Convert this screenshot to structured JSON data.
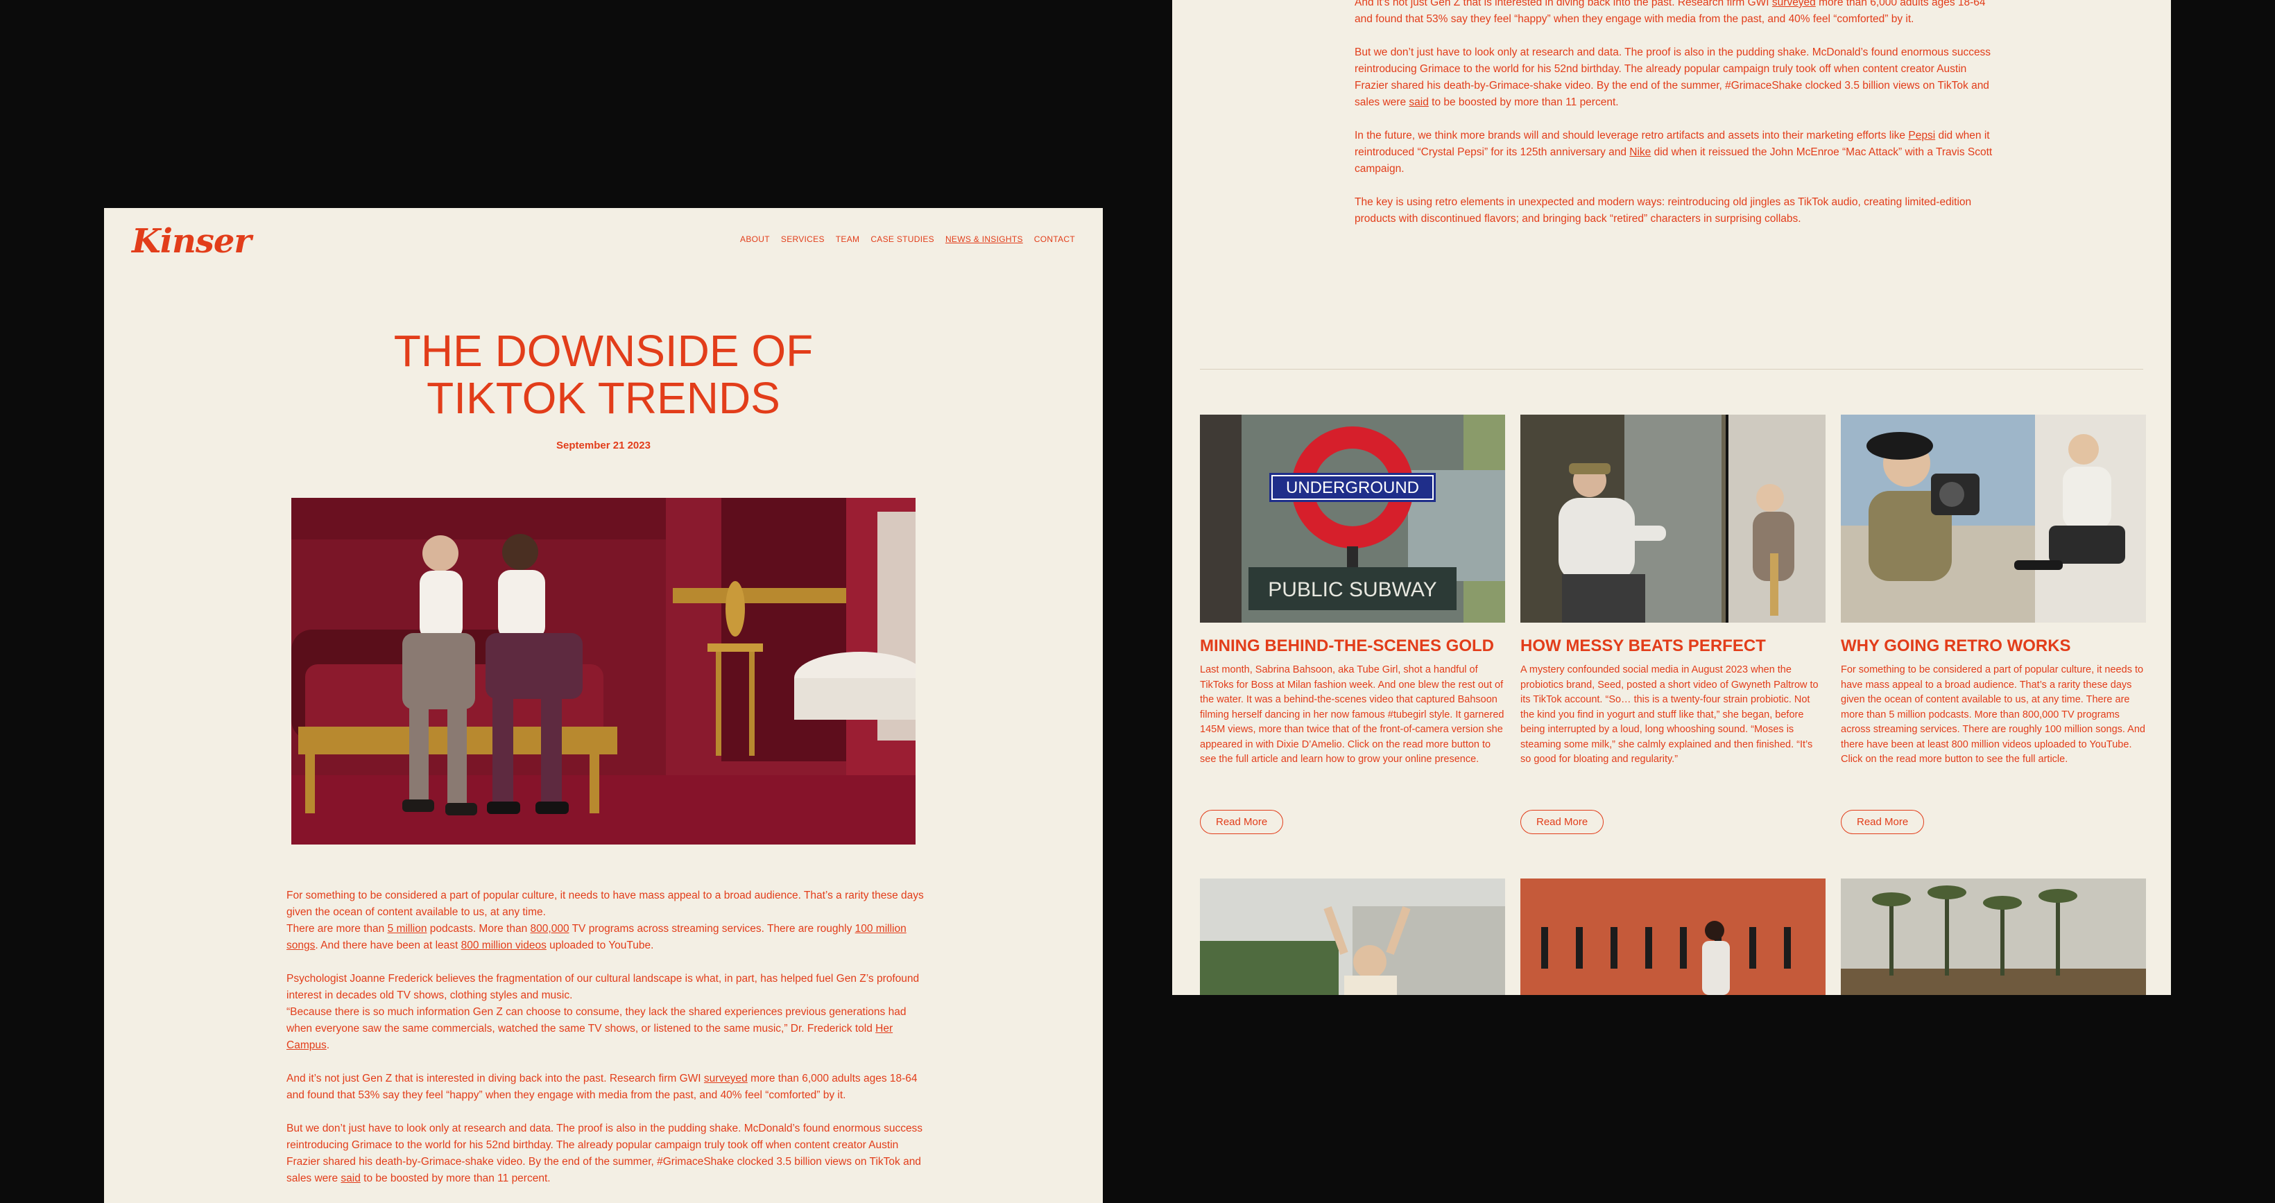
{
  "brand": {
    "logo": "Kinser",
    "color": "#e23d1a",
    "background": "#f3efe4"
  },
  "nav": [
    {
      "label": "ABOUT"
    },
    {
      "label": "SERVICES"
    },
    {
      "label": "TEAM"
    },
    {
      "label": "CASE STUDIES"
    },
    {
      "label": "NEWS & INSIGHTS",
      "active": true
    },
    {
      "label": "CONTACT"
    }
  ],
  "article": {
    "title_line1": "THE DOWNSIDE OF",
    "title_line2": "TIKTOK TRENDS",
    "date": "September 21 2023",
    "p1": {
      "a": "For something to be considered a part of popular culture, it needs to have mass appeal to a broad audience. That’s a rarity these days given the ocean of content available to us, at any time.",
      "b": "There are more than ",
      "l1": "5 million",
      "c": " podcasts. More than ",
      "l2": "800,000",
      "d": " TV programs across streaming services. There are roughly ",
      "l3": "100 million songs",
      "e": ". And there have been at least ",
      "l4": "800 million videos",
      "f": " uploaded to YouTube."
    },
    "p2": {
      "a": "Psychologist Joanne Frederick believes the fragmentation of our cultural landscape is what, in part, has helped fuel Gen Z’s profound interest in decades old TV shows, clothing styles and music.",
      "b": "“Because there is so much information Gen Z can choose to consume, they lack the shared experiences previous generations had when everyone saw the same commercials, watched the same TV shows, or listened to the same music,” Dr. Frederick told ",
      "l1": "Her Campus",
      "c": "."
    },
    "p3": {
      "a": "And it’s not just Gen Z that is interested in diving back into the past. Research firm GWI ",
      "l1": "surveyed",
      "b": " more than 6,000 adults ages 18-64 and found that 53% say they feel “happy” when they engage with media from the past, and 40% feel “comforted” by it."
    },
    "p4": {
      "a": "But we don’t just have to look only at research and data. The proof is also in the pudding shake. McDonald’s found enormous success reintroducing Grimace to the world for his 52nd birthday. The already popular campaign truly took off when content creator Austin Frazier shared his death-by-Grimace-shake video. By the end of the summer, #GrimaceShake clocked 3.5 billion views on TikTok and sales were ",
      "l1": "said",
      "b": " to be boosted by more than 11 percent."
    },
    "p5": {
      "a": "In the future, we think more brands will and should leverage retro artifacts and assets into their marketing efforts like ",
      "l1": "Pepsi",
      "b": " did when it reintroduced “Crystal Pepsi” for its 125th anniversary and ",
      "l2": "Nike",
      "c": " did when it reissued the John McEnroe “Mac Attack” with a Travis Scott campaign."
    },
    "p6": "The key is using retro elements in unexpected and modern ways: reintroducing old jingles as TikTok audio, creating limited-edition products with discontinued flavors; and bringing back “retired” characters in surprising collabs."
  },
  "cards": [
    {
      "title": "MINING BEHIND-THE-SCENES GOLD",
      "body": "Last month, Sabrina Bahsoon, aka Tube Girl, shot a handful of TikToks for Boss at Milan fashion week. And one blew the rest out of the water. It was a behind-the-scenes video that captured Bahsoon filming herself dancing in her now famous #tubegirl style. It garnered 145M views, more than twice that of the front-of-camera version she appeared in with Dixie D’Amelio. Click on the read more button to see the full article and learn how to grow your online presence.",
      "button": "Read More",
      "sign_top": "UNDERGROUND",
      "sign_bottom": "PUBLIC SUBWAY"
    },
    {
      "title": "HOW MESSY BEATS PERFECT",
      "body": "A mystery confounded social media in August 2023 when the probiotics brand, Seed, posted a short video of Gwyneth Paltrow to its TikTok account. “So… this is a twenty-four strain probiotic. Not the kind you find in yogurt and stuff like that,” she began, before being interrupted by a loud, long whooshing sound. “Moses is steaming some milk,” she calmly explained and then finished. “It’s so good for bloating and regularity.”",
      "button": "Read More"
    },
    {
      "title": "WHY GOING RETRO WORKS",
      "body": "For something to be considered a part of popular culture, it needs to have mass appeal to a broad audience. That’s a rarity these days given the ocean of content available to us, at any time. There are more than 5 million podcasts. More than 800,000 TV programs across streaming services. There are roughly 100 million songs. And there have been at least 800 million videos uploaded to YouTube.  Click on the read more button to see the full article.",
      "button": "Read More"
    }
  ]
}
